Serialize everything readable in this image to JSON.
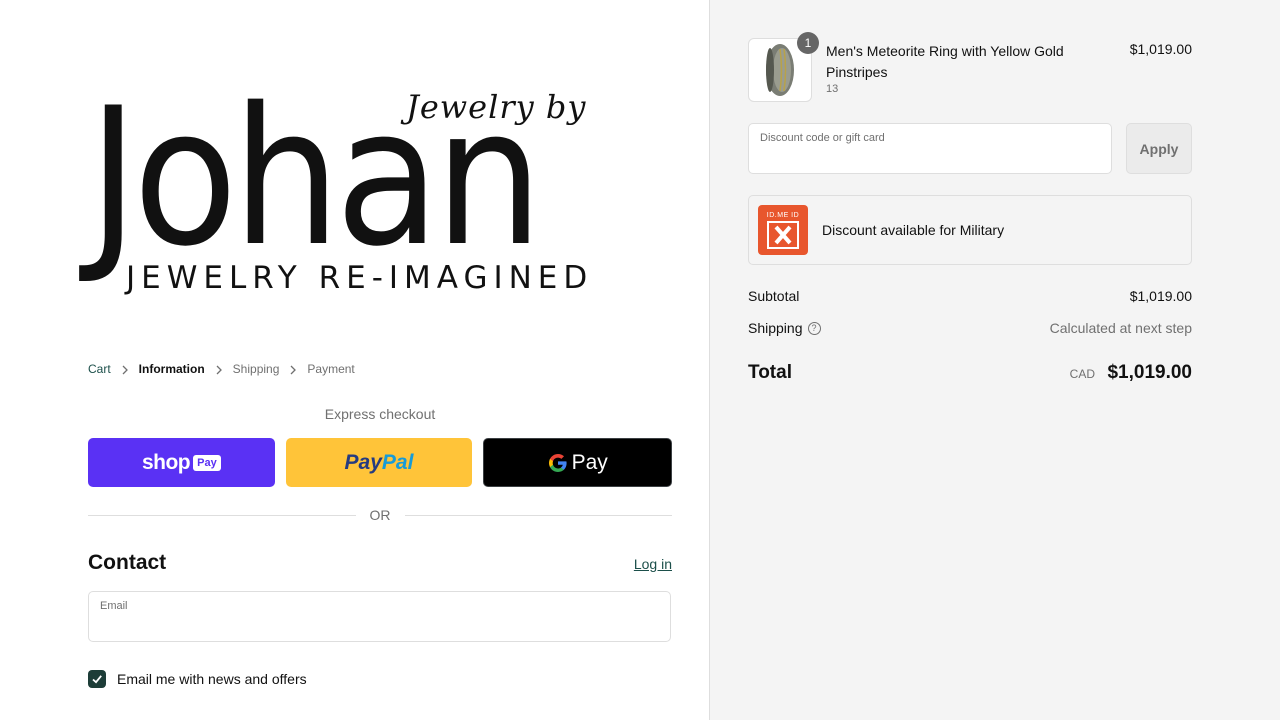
{
  "store": {
    "logo_script": "Jewelry by",
    "logo_name": "Johan",
    "logo_tagline": "JEWELRY RE-IMAGINED"
  },
  "breadcrumb": [
    {
      "label": "Cart",
      "state": "link"
    },
    {
      "label": "Information",
      "state": "active"
    },
    {
      "label": "Shipping",
      "state": "inactive"
    },
    {
      "label": "Payment",
      "state": "inactive"
    }
  ],
  "express": {
    "label": "Express checkout",
    "shop_pay": {
      "shop": "shop",
      "pay": "Pay"
    },
    "paypal": {
      "pay": "Pay",
      "pal": "Pal"
    },
    "gpay": {
      "g": "G",
      "pay": "Pay"
    }
  },
  "divider": {
    "or": "OR"
  },
  "contact": {
    "title": "Contact",
    "login_link": "Log in",
    "email_label": "Email",
    "email_value": "",
    "newsletter_label": "Email me with news and offers",
    "newsletter_checked": true
  },
  "cart": {
    "product": {
      "name": "Men's Meteorite Ring with Yellow Gold Pinstripes",
      "variant": "13",
      "price": "$1,019.00",
      "quantity": "1"
    },
    "discount": {
      "label": "Discount code or gift card",
      "value": "",
      "apply_label": "Apply"
    },
    "military": {
      "logo_text": "ID.ME ID",
      "text": "Discount available for Military"
    },
    "subtotal": {
      "label": "Subtotal",
      "value": "$1,019.00"
    },
    "shipping": {
      "label": "Shipping",
      "value": "Calculated at next step"
    },
    "total": {
      "label": "Total",
      "currency": "CAD",
      "value": "$1,019.00"
    }
  },
  "colors": {
    "accent": "#1c4f4a",
    "shop_pay": "#5a31f4",
    "paypal": "#ffc439",
    "gpay": "#000000",
    "idme": "#e8562d",
    "sidebar_bg": "#f4f4f4"
  }
}
